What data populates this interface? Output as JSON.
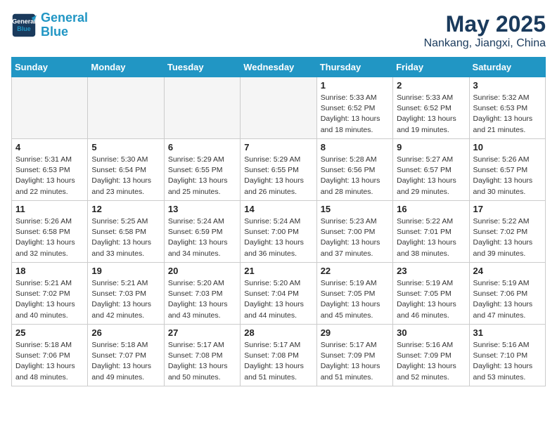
{
  "header": {
    "logo_line1": "General",
    "logo_line2": "Blue",
    "title": "May 2025",
    "subtitle": "Nankang, Jiangxi, China"
  },
  "weekdays": [
    "Sunday",
    "Monday",
    "Tuesday",
    "Wednesday",
    "Thursday",
    "Friday",
    "Saturday"
  ],
  "weeks": [
    [
      {
        "day": "",
        "info": ""
      },
      {
        "day": "",
        "info": ""
      },
      {
        "day": "",
        "info": ""
      },
      {
        "day": "",
        "info": ""
      },
      {
        "day": "1",
        "info": "Sunrise: 5:33 AM\nSunset: 6:52 PM\nDaylight: 13 hours\nand 18 minutes."
      },
      {
        "day": "2",
        "info": "Sunrise: 5:33 AM\nSunset: 6:52 PM\nDaylight: 13 hours\nand 19 minutes."
      },
      {
        "day": "3",
        "info": "Sunrise: 5:32 AM\nSunset: 6:53 PM\nDaylight: 13 hours\nand 21 minutes."
      }
    ],
    [
      {
        "day": "4",
        "info": "Sunrise: 5:31 AM\nSunset: 6:53 PM\nDaylight: 13 hours\nand 22 minutes."
      },
      {
        "day": "5",
        "info": "Sunrise: 5:30 AM\nSunset: 6:54 PM\nDaylight: 13 hours\nand 23 minutes."
      },
      {
        "day": "6",
        "info": "Sunrise: 5:29 AM\nSunset: 6:55 PM\nDaylight: 13 hours\nand 25 minutes."
      },
      {
        "day": "7",
        "info": "Sunrise: 5:29 AM\nSunset: 6:55 PM\nDaylight: 13 hours\nand 26 minutes."
      },
      {
        "day": "8",
        "info": "Sunrise: 5:28 AM\nSunset: 6:56 PM\nDaylight: 13 hours\nand 28 minutes."
      },
      {
        "day": "9",
        "info": "Sunrise: 5:27 AM\nSunset: 6:57 PM\nDaylight: 13 hours\nand 29 minutes."
      },
      {
        "day": "10",
        "info": "Sunrise: 5:26 AM\nSunset: 6:57 PM\nDaylight: 13 hours\nand 30 minutes."
      }
    ],
    [
      {
        "day": "11",
        "info": "Sunrise: 5:26 AM\nSunset: 6:58 PM\nDaylight: 13 hours\nand 32 minutes."
      },
      {
        "day": "12",
        "info": "Sunrise: 5:25 AM\nSunset: 6:58 PM\nDaylight: 13 hours\nand 33 minutes."
      },
      {
        "day": "13",
        "info": "Sunrise: 5:24 AM\nSunset: 6:59 PM\nDaylight: 13 hours\nand 34 minutes."
      },
      {
        "day": "14",
        "info": "Sunrise: 5:24 AM\nSunset: 7:00 PM\nDaylight: 13 hours\nand 36 minutes."
      },
      {
        "day": "15",
        "info": "Sunrise: 5:23 AM\nSunset: 7:00 PM\nDaylight: 13 hours\nand 37 minutes."
      },
      {
        "day": "16",
        "info": "Sunrise: 5:22 AM\nSunset: 7:01 PM\nDaylight: 13 hours\nand 38 minutes."
      },
      {
        "day": "17",
        "info": "Sunrise: 5:22 AM\nSunset: 7:02 PM\nDaylight: 13 hours\nand 39 minutes."
      }
    ],
    [
      {
        "day": "18",
        "info": "Sunrise: 5:21 AM\nSunset: 7:02 PM\nDaylight: 13 hours\nand 40 minutes."
      },
      {
        "day": "19",
        "info": "Sunrise: 5:21 AM\nSunset: 7:03 PM\nDaylight: 13 hours\nand 42 minutes."
      },
      {
        "day": "20",
        "info": "Sunrise: 5:20 AM\nSunset: 7:03 PM\nDaylight: 13 hours\nand 43 minutes."
      },
      {
        "day": "21",
        "info": "Sunrise: 5:20 AM\nSunset: 7:04 PM\nDaylight: 13 hours\nand 44 minutes."
      },
      {
        "day": "22",
        "info": "Sunrise: 5:19 AM\nSunset: 7:05 PM\nDaylight: 13 hours\nand 45 minutes."
      },
      {
        "day": "23",
        "info": "Sunrise: 5:19 AM\nSunset: 7:05 PM\nDaylight: 13 hours\nand 46 minutes."
      },
      {
        "day": "24",
        "info": "Sunrise: 5:19 AM\nSunset: 7:06 PM\nDaylight: 13 hours\nand 47 minutes."
      }
    ],
    [
      {
        "day": "25",
        "info": "Sunrise: 5:18 AM\nSunset: 7:06 PM\nDaylight: 13 hours\nand 48 minutes."
      },
      {
        "day": "26",
        "info": "Sunrise: 5:18 AM\nSunset: 7:07 PM\nDaylight: 13 hours\nand 49 minutes."
      },
      {
        "day": "27",
        "info": "Sunrise: 5:17 AM\nSunset: 7:08 PM\nDaylight: 13 hours\nand 50 minutes."
      },
      {
        "day": "28",
        "info": "Sunrise: 5:17 AM\nSunset: 7:08 PM\nDaylight: 13 hours\nand 51 minutes."
      },
      {
        "day": "29",
        "info": "Sunrise: 5:17 AM\nSunset: 7:09 PM\nDaylight: 13 hours\nand 51 minutes."
      },
      {
        "day": "30",
        "info": "Sunrise: 5:16 AM\nSunset: 7:09 PM\nDaylight: 13 hours\nand 52 minutes."
      },
      {
        "day": "31",
        "info": "Sunrise: 5:16 AM\nSunset: 7:10 PM\nDaylight: 13 hours\nand 53 minutes."
      }
    ]
  ]
}
